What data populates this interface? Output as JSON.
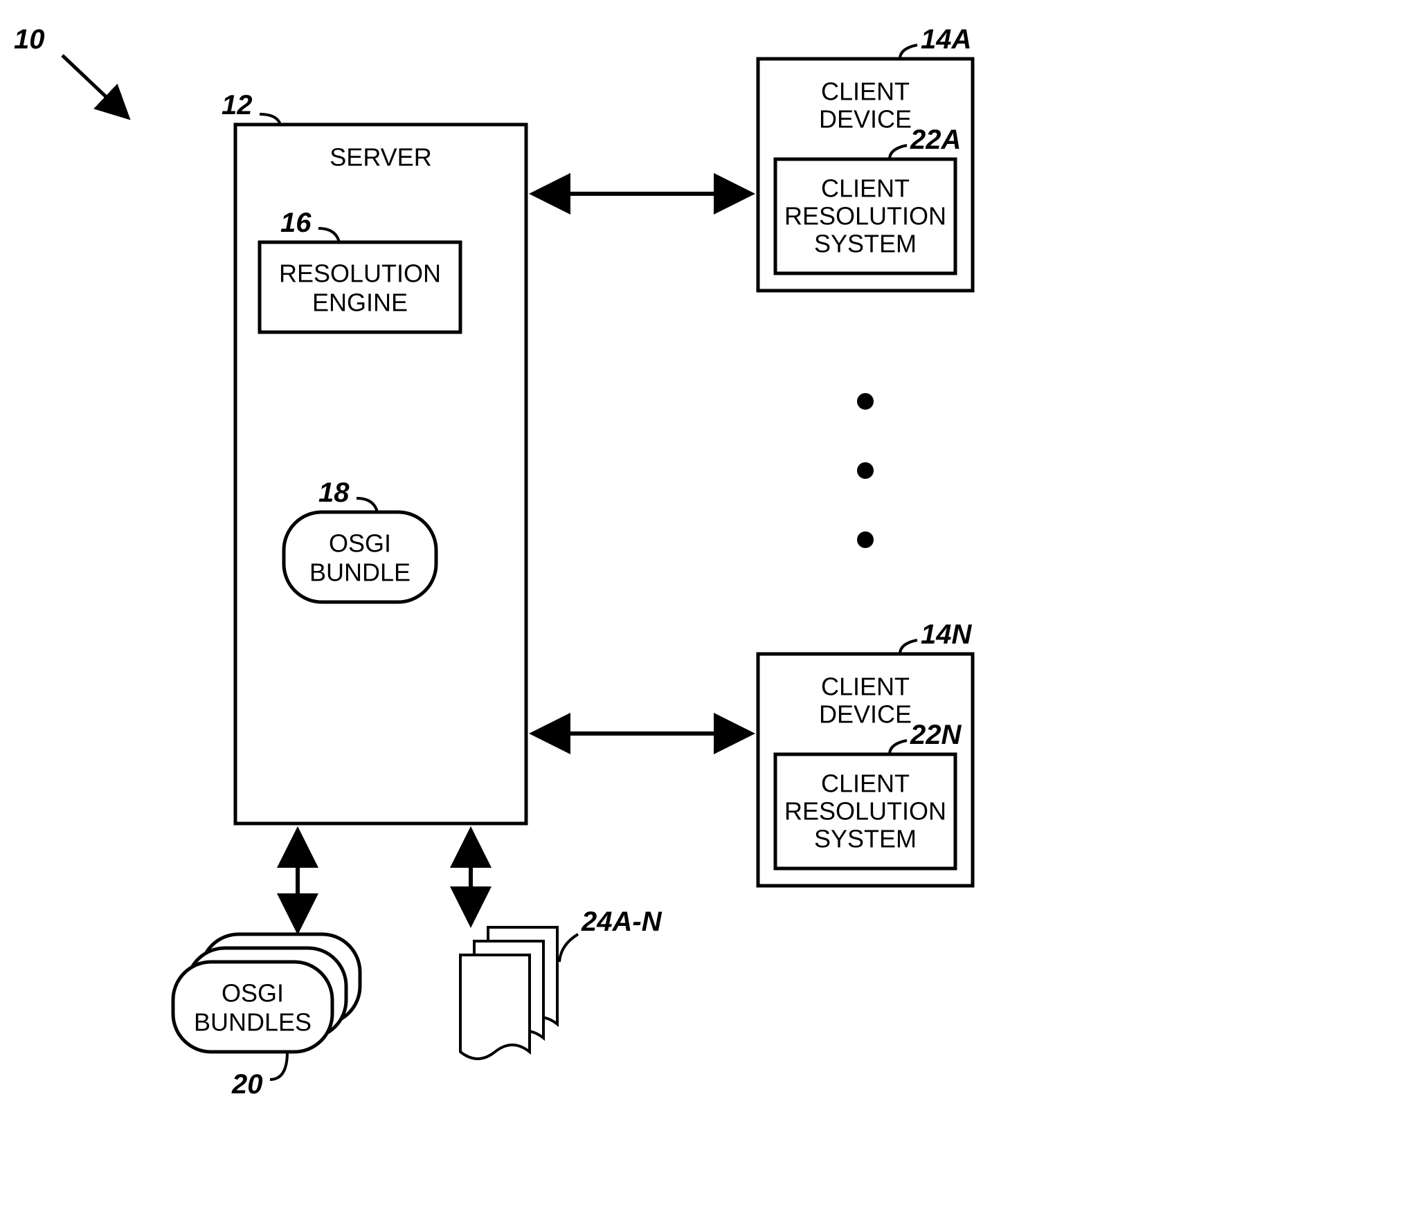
{
  "labels": {
    "system_ref": "10",
    "server_ref": "12",
    "server_title": "SERVER",
    "resolution_engine_ref": "16",
    "resolution_engine_line1": "RESOLUTION",
    "resolution_engine_line2": "ENGINE",
    "osgi_bundle_ref": "18",
    "osgi_bundle_line1": "OSGI",
    "osgi_bundle_line2": "BUNDLE",
    "osgi_bundles_ref": "20",
    "osgi_bundles_line1": "OSGI",
    "osgi_bundles_line2": "BUNDLES",
    "docs_ref": "24A-N",
    "client_a_ref": "14A",
    "client_a_title1": "CLIENT",
    "client_a_title2": "DEVICE",
    "crs_a_ref": "22A",
    "crs_a_line1": "CLIENT",
    "crs_a_line2": "RESOLUTION",
    "crs_a_line3": "SYSTEM",
    "client_n_ref": "14N",
    "client_n_title1": "CLIENT",
    "client_n_title2": "DEVICE",
    "crs_n_ref": "22N",
    "crs_n_line1": "CLIENT",
    "crs_n_line2": "RESOLUTION",
    "crs_n_line3": "SYSTEM"
  }
}
